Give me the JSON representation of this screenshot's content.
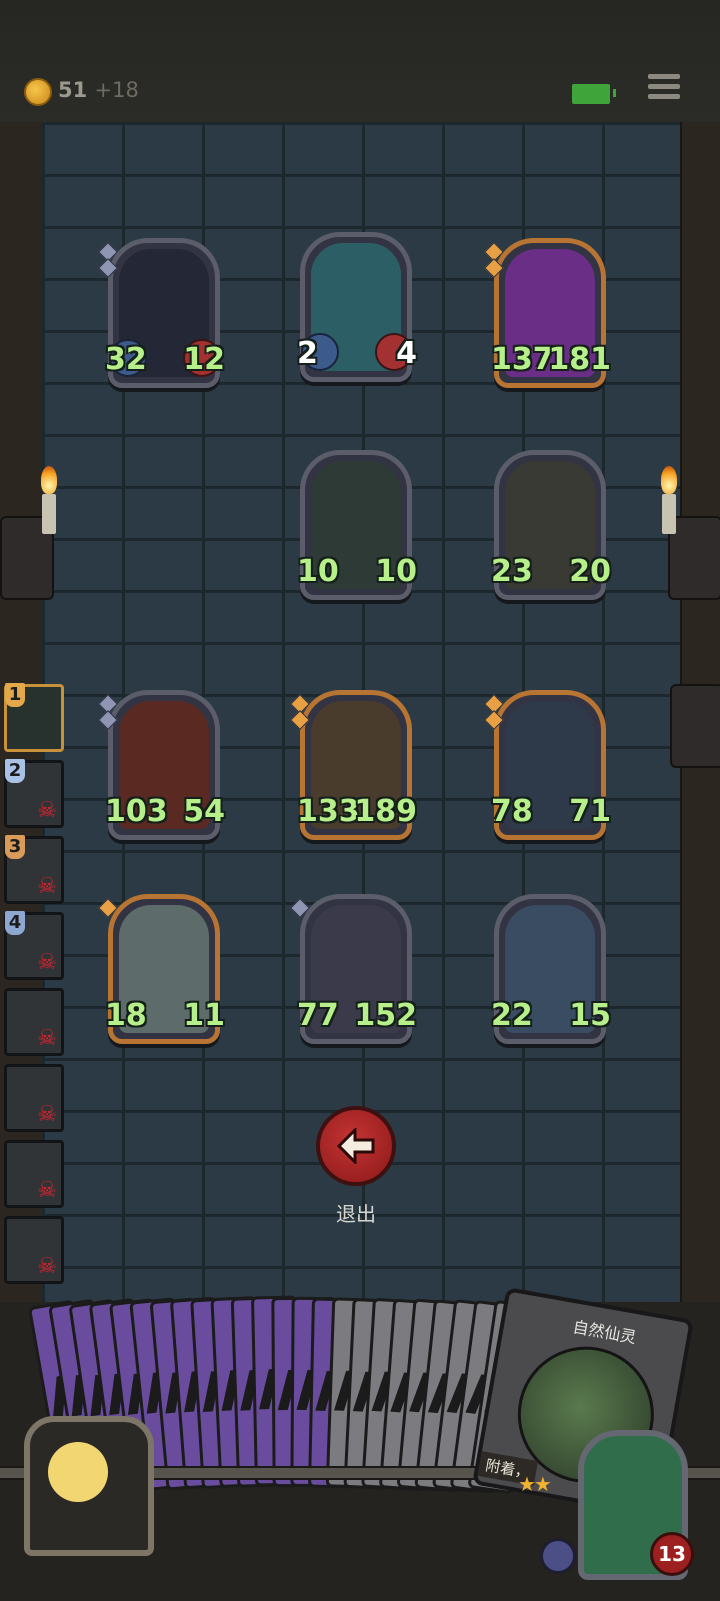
{
  "header": {
    "coins": "51",
    "coins_bonus": "+18"
  },
  "board": [
    {
      "row": 1,
      "col": 1,
      "frame": "silver",
      "atk": "32",
      "hp": "12",
      "art_color": "#242736"
    },
    {
      "row": 1,
      "col": 2,
      "frame": "silver",
      "atk": "2",
      "hp": "4",
      "art_color": "#2c5e66"
    },
    {
      "row": 1,
      "col": 3,
      "frame": "gold",
      "atk": "137",
      "hp": "181",
      "art_color": "#6a2e86"
    },
    {
      "row": 2,
      "col": 2,
      "frame": "silver",
      "atk": "10",
      "hp": "10",
      "art_color": "#2e3a36"
    },
    {
      "row": 2,
      "col": 3,
      "frame": "silver",
      "atk": "23",
      "hp": "20",
      "art_color": "#3a3a34"
    },
    {
      "row": 3,
      "col": 1,
      "frame": "silver",
      "atk": "103",
      "hp": "54",
      "art_color": "#5a2a22"
    },
    {
      "row": 3,
      "col": 2,
      "frame": "gold",
      "atk": "133",
      "hp": "189",
      "art_color": "#4a3c2c"
    },
    {
      "row": 3,
      "col": 3,
      "frame": "gold",
      "atk": "78",
      "hp": "71",
      "art_color": "#2e3a4a"
    },
    {
      "row": 4,
      "col": 1,
      "frame": "gold",
      "atk": "18",
      "hp": "11",
      "art_color": "#5d6c6a"
    },
    {
      "row": 4,
      "col": 2,
      "frame": "silver",
      "atk": "77",
      "hp": "152",
      "art_color": "#3a3a4a"
    },
    {
      "row": 4,
      "col": 3,
      "frame": "silver",
      "atk": "22",
      "hp": "15",
      "art_color": "#3a4c62"
    }
  ],
  "exit": {
    "label": "退出"
  },
  "queue": [
    {
      "num": "1",
      "active": true
    },
    {
      "num": "2"
    },
    {
      "num": "3"
    },
    {
      "num": "4"
    },
    {
      "num": ""
    },
    {
      "num": ""
    },
    {
      "num": ""
    },
    {
      "num": ""
    }
  ],
  "hand": {
    "card_name": "自然仙灵",
    "card_text": "附着，",
    "stars": "★★"
  },
  "boss": {
    "count": "13"
  },
  "icons": {
    "exit": "arrow-left-icon",
    "menu": "menu-icon",
    "skull": "skull-icon",
    "shield": "shield-icon"
  }
}
